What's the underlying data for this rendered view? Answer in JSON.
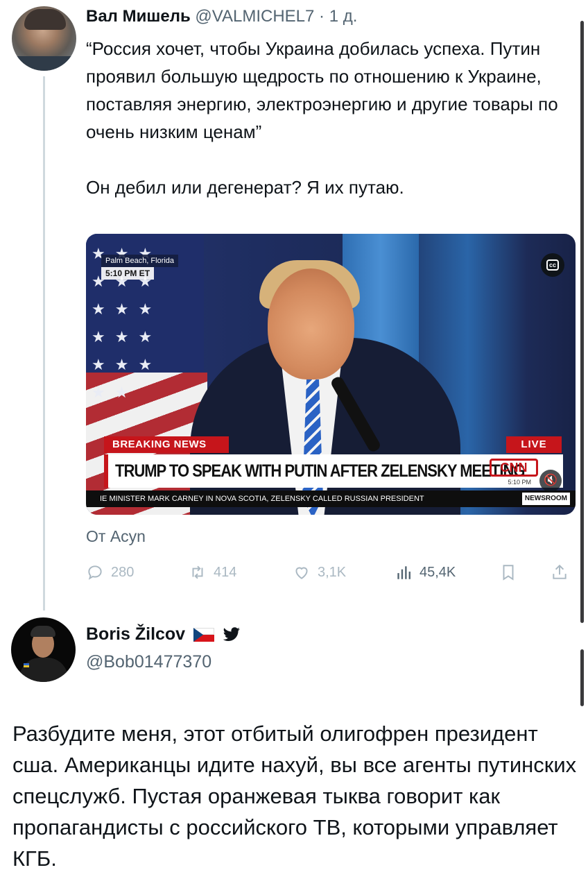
{
  "tweet1": {
    "author_name": "Вал Мишель",
    "handle": "@VALMICHEL7",
    "separator": " · ",
    "time": "1 д.",
    "body": "“Россия хочет, чтобы Украина добилась успеха. Путин проявил большую щедрость по отношению к Украине, поставляя энергию, электроэнергию и другие товары по очень низким ценам”\n\nОн дебил или дегенерат? Я их путаю.",
    "attribution": "От Acyn",
    "video": {
      "location": "Palm Beach, Florida",
      "time": "5:10 PM ET",
      "cc_label": "cc",
      "breaking": "BREAKING NEWS",
      "live": "LIVE",
      "headline": "TRUMP TO SPEAK WITH PUTIN AFTER ZELENSKY MEETING",
      "network": "CNN",
      "network_time": "5:10 PM",
      "ticker": "IE MINISTER MARK CARNEY IN NOVA SCOTIA, ZELENSKY CALLED RUSSIAN PRESIDENT",
      "ticker_tag": "NEWSROOM"
    },
    "metrics": {
      "replies": "280",
      "retweets": "414",
      "likes": "3,1K",
      "views": "45,4K"
    }
  },
  "tweet2": {
    "author_name": "Boris Žilcov",
    "handle": "@Bob01477370",
    "body": "Разбудите меня, этот отбитый олигофрен президент сша. Американцы идите нахуй, вы все агенты путинских спецслужб. Пустая оранжевая тыква говорит как пропагандисты с российского ТВ, которыми управляет КГБ."
  },
  "colors": {
    "text_primary": "#0f1419",
    "text_secondary": "#536471",
    "action_muted": "#aab8c2",
    "cnn_red": "#c6151b"
  },
  "icons": [
    "reply-icon",
    "retweet-icon",
    "like-icon",
    "views-icon",
    "bookmark-icon",
    "share-icon",
    "cc-icon",
    "mute-icon",
    "czech-flag-icon",
    "twitter-bird-icon"
  ]
}
